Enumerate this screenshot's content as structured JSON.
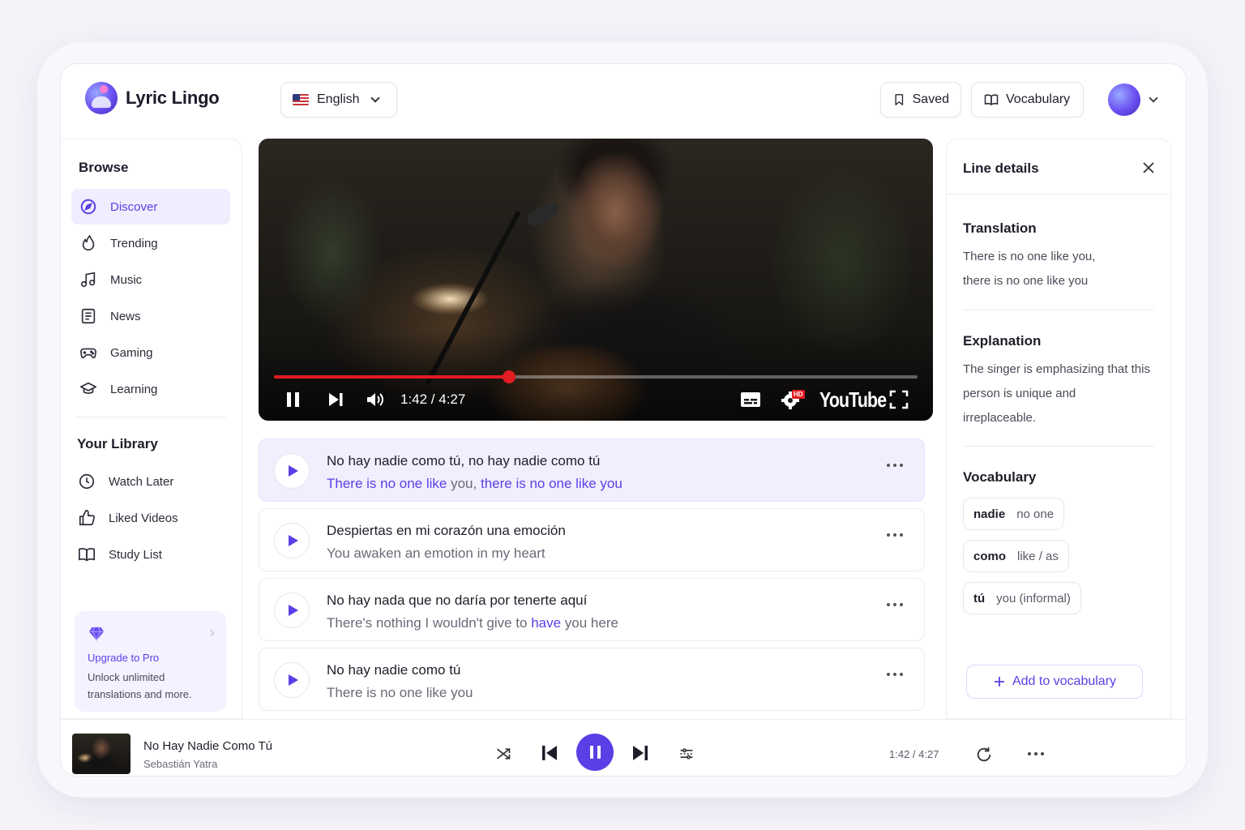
{
  "header": {
    "app_name": "Lyric Lingo",
    "language": "English",
    "saved_label": "Saved",
    "vocabulary_label": "Vocabulary"
  },
  "sidebar": {
    "browse_title": "Browse",
    "browse_items": [
      {
        "label": "Discover",
        "icon": "compass-icon",
        "active": true
      },
      {
        "label": "Trending",
        "icon": "flame-icon"
      },
      {
        "label": "Music",
        "icon": "music-note-icon"
      },
      {
        "label": "News",
        "icon": "newspaper-icon"
      },
      {
        "label": "Gaming",
        "icon": "gamepad-icon"
      },
      {
        "label": "Learning",
        "icon": "graduation-cap-icon"
      }
    ],
    "library_title": "Your Library",
    "library_items": [
      {
        "label": "Watch Later",
        "icon": "clock-icon"
      },
      {
        "label": "Liked Videos",
        "icon": "thumbs-up-icon"
      },
      {
        "label": "Study List",
        "icon": "book-icon"
      }
    ],
    "pro": {
      "title": "Upgrade to Pro",
      "description": "Unlock unlimited translations and more."
    }
  },
  "video": {
    "time": "1:42 / 4:27",
    "progress_fraction": 0.365,
    "brand": "YouTube",
    "settings_badge": "HD",
    "accent_color": "#e31b23"
  },
  "lyrics": [
    {
      "original": "No hay nadie como tú, no hay nadie como tú",
      "translation_parts": [
        {
          "text": "There is no one like",
          "hl": true
        },
        {
          "text": " you, ",
          "hl": false
        },
        {
          "text": "there is no one like you",
          "hl": true
        }
      ],
      "active": true
    },
    {
      "original": "Despiertas en mi corazón una emoción",
      "translation_parts": [
        {
          "text": "You awaken an emotion in my heart",
          "hl": false
        }
      ]
    },
    {
      "original": "No hay nada que no daría por tenerte aquí",
      "translation_parts": [
        {
          "text": "There's nothing I wouldn't give to ",
          "hl": false
        },
        {
          "text": "have",
          "hl": true
        },
        {
          "text": " you here",
          "hl": false
        }
      ]
    },
    {
      "original": "No hay nadie como tú",
      "translation_parts": [
        {
          "text": "There is no one like you",
          "hl": false
        }
      ]
    }
  ],
  "details": {
    "title": "Line details",
    "translation_heading": "Translation",
    "translation_text": "There is no one like you, there is no one like you",
    "explanation_heading": "Explanation",
    "explanation_text": "The singer is emphasizing that this person is unique and irreplaceable.",
    "vocabulary_heading": "Vocabulary",
    "vocab": [
      {
        "word": "nadie",
        "meaning": "no one"
      },
      {
        "word": "como",
        "meaning": "like / as"
      },
      {
        "word": "tú",
        "meaning": "you (informal)"
      }
    ],
    "add_label": "Add to vocabulary"
  },
  "player": {
    "title": "No Hay Nadie Como Tú",
    "artist": "Sebastián Yatra",
    "time": "1:42 / 4:27"
  },
  "colors": {
    "accent": "#5b3fe6",
    "accent_soft": "#f1effd"
  }
}
